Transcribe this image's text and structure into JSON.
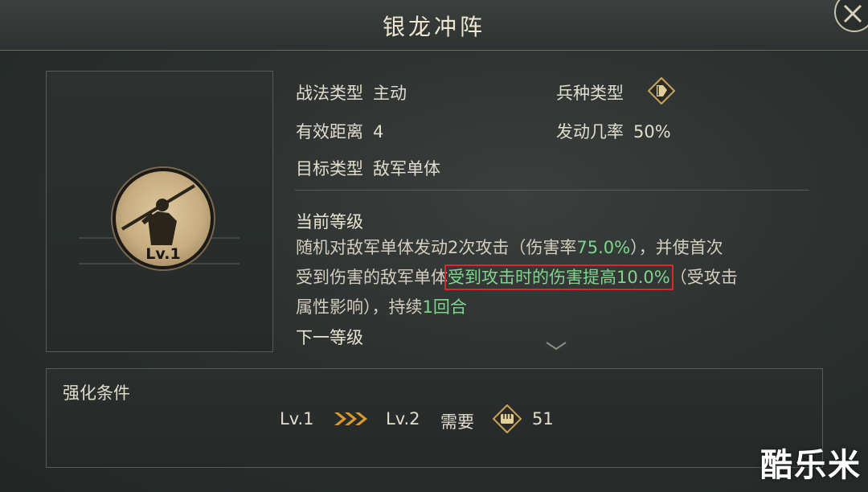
{
  "header": {
    "title": "银龙冲阵"
  },
  "portrait": {
    "level": "Lv.1"
  },
  "attributes": {
    "tactic_type_label": "战法类型",
    "tactic_type_value": "主动",
    "unit_type_label": "兵种类型",
    "unit_type_icon": "unit-type-icon",
    "range_label": "有效距离",
    "range_value": "4",
    "trigger_rate_label": "发动几率",
    "trigger_rate_value": "50%",
    "target_label": "目标类型",
    "target_value": "敌军单体"
  },
  "current_level": {
    "heading": "当前等级",
    "line1_a": "随机对敌军单体发动2次攻击（伤害率",
    "line1_rate": "75.0%",
    "line1_b": "），并使首次",
    "line2_a": "受到伤害的敌军单体",
    "line2_hl_text": "受到攻击时的伤害提高",
    "line2_hl_value": "10.0%",
    "line2_b": "（受攻击",
    "line3_a": "属性影响），持续",
    "line3_dur": "1回合"
  },
  "next_level": {
    "heading": "下一等级"
  },
  "enhance": {
    "title": "强化条件",
    "from_level": "Lv.1",
    "to_level": "Lv.2",
    "need_label": "需要",
    "cost_icon": "fist-icon",
    "cost_value": "51"
  },
  "watermark": "酷乐米",
  "colors": {
    "highlight_green": "#7fd58d",
    "highlight_box": "#e0262b",
    "accent_gold": "#c9a35a"
  }
}
